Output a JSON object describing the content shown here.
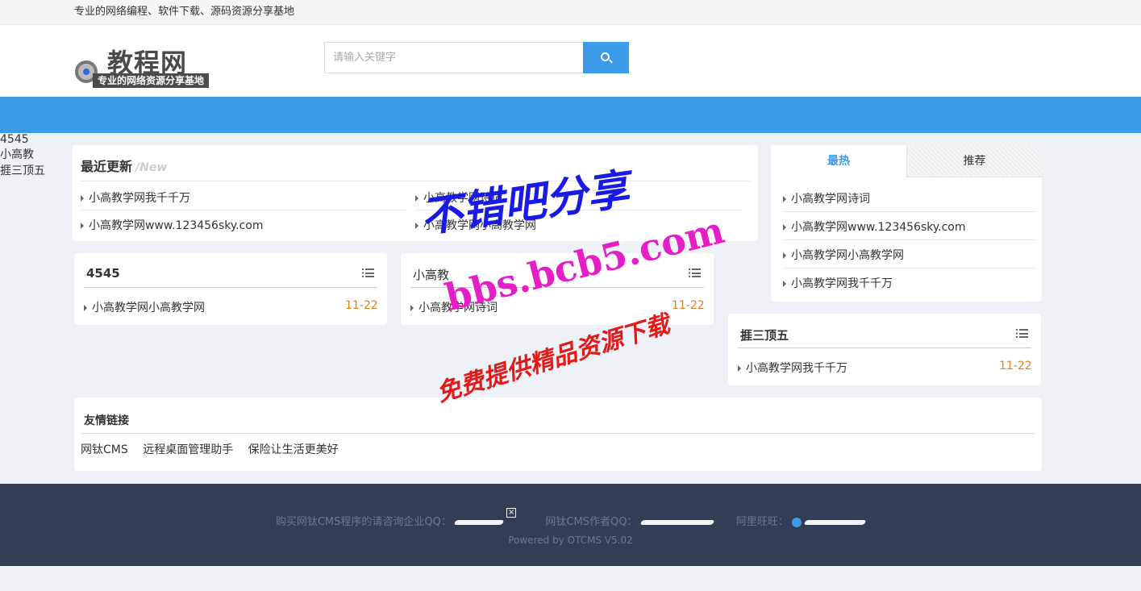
{
  "topbar": {
    "tagline": "专业的网络编程、软件下载、源码资源分享基地"
  },
  "logo": {
    "title": "教程网",
    "subtitle": "专业的网络资源分享基地"
  },
  "search": {
    "placeholder": "请输入关键字"
  },
  "nav": {
    "items": [
      "4545",
      "小高教",
      "捱三顶五"
    ]
  },
  "recent": {
    "title": "最近更新",
    "title_en": "/New",
    "items": [
      "小高教学网我千千万",
      "小高教学网诗词",
      "小高教学网www.123456sky.com",
      "小高教学网小高教学网"
    ]
  },
  "side_tabs": {
    "hot": "最热",
    "recommend": "推荐"
  },
  "hot_list": {
    "items": [
      "小高教学网诗词",
      "小高教学网www.123456sky.com",
      "小高教学网小高教学网",
      "小高教学网我千千万"
    ]
  },
  "cat_4545": {
    "title": "4545",
    "item": "小高教学网小高教学网",
    "date": "11-22"
  },
  "cat_xiaogao": {
    "title": "小高教",
    "item": "小高教学网诗词",
    "date": "11-22"
  },
  "cat_aisan": {
    "title": "捱三顶五",
    "item": "小高教学网我千千万",
    "date": "11-22"
  },
  "friend_links": {
    "title": "友情链接",
    "items": [
      "网钛CMS",
      "远程桌面管理助手",
      "保险让生活更美好"
    ]
  },
  "footer": {
    "buy_label": "购买网钛CMS程序的请咨询企业QQ：",
    "author_label": "网钛CMS作者QQ：",
    "wangwang_label": "阿里旺旺：",
    "powered": "Powered by OTCMS V5.02",
    "close_glyph": "×"
  },
  "watermark": {
    "line1": "不错吧分享",
    "line2": "bbs.bcb5.com",
    "line3": "免费提供精品资源下载"
  },
  "colors": {
    "accent": "#3b9be9",
    "date": "#e67e22",
    "footer_bg": "#333d53",
    "page_bg": "#eef1f6"
  }
}
